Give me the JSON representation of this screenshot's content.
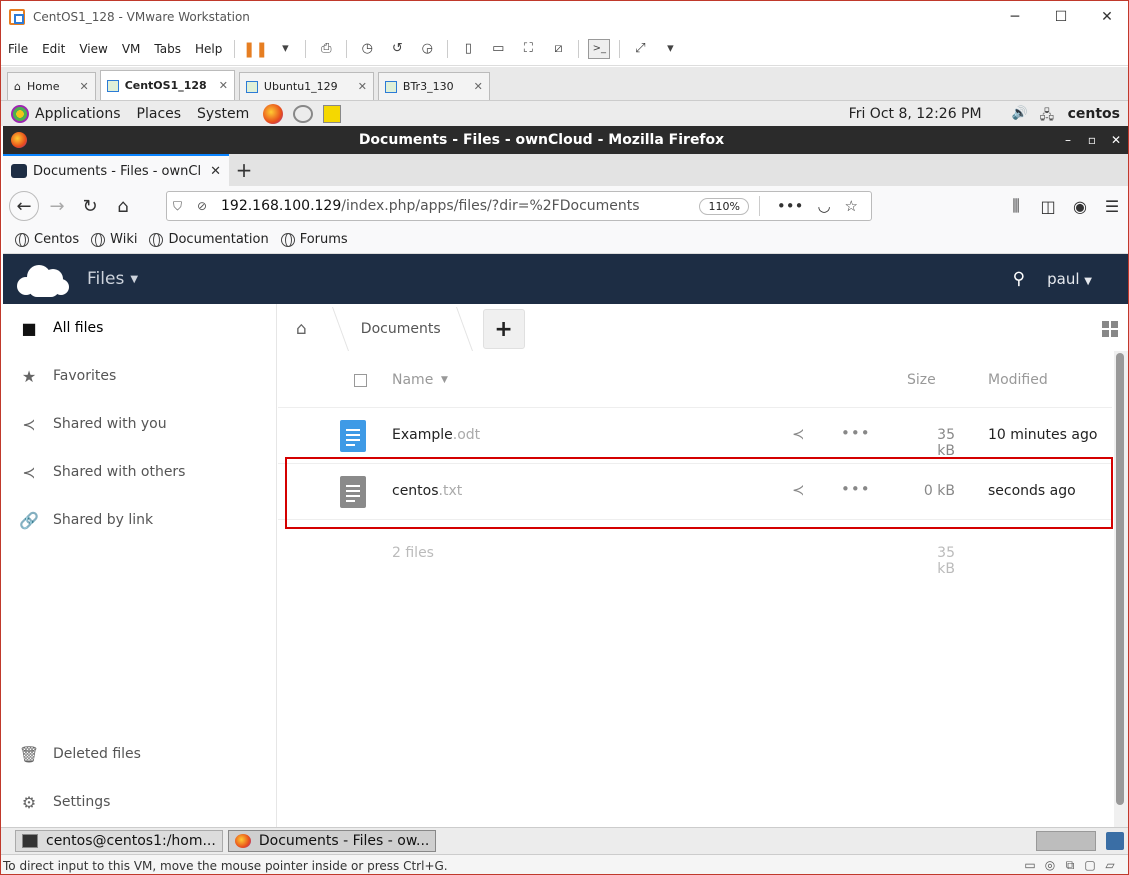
{
  "vmware": {
    "title": "CentOS1_128 - VMware Workstation",
    "menu": [
      "File",
      "Edit",
      "View",
      "VM",
      "Tabs",
      "Help"
    ],
    "tabs": [
      {
        "label": "Home"
      },
      {
        "label": "CentOS1_128"
      },
      {
        "label": "Ubuntu1_129"
      },
      {
        "label": "BTr3_130"
      }
    ],
    "status": "To direct input to this VM, move the mouse pointer inside or press Ctrl+G."
  },
  "gnome": {
    "menus": [
      "Applications",
      "Places",
      "System"
    ],
    "clock": "Fri Oct  8, 12:26 PM",
    "user": "centos"
  },
  "firefox": {
    "window_title": "Documents - Files - ownCloud - Mozilla Firefox",
    "tab_label": "Documents - Files - ownCl",
    "url_host": "192.168.100.129",
    "url_path": "/index.php/apps/files/?dir=%2FDocuments",
    "zoom": "110%",
    "bookmarks": [
      "Centos",
      "Wiki",
      "Documentation",
      "Forums"
    ]
  },
  "owncloud": {
    "app_name": "Files",
    "user": "paul",
    "sidebar": {
      "items": [
        "All files",
        "Favorites",
        "Shared with you",
        "Shared with others",
        "Shared by link"
      ],
      "bottom": [
        "Deleted files",
        "Settings"
      ]
    },
    "breadcrumb": "Documents",
    "columns": {
      "name": "Name",
      "size": "Size",
      "modified": "Modified"
    },
    "files": [
      {
        "name": "Example",
        "ext": ".odt",
        "size": "35 kB",
        "modified": "10 minutes ago",
        "icon_color": "#3e9ae6"
      },
      {
        "name": "centos",
        "ext": ".txt",
        "size": "0 kB",
        "modified": "seconds ago",
        "icon_color": "#8a8a8a"
      }
    ],
    "summary": {
      "count": "2 files",
      "total": "35 kB"
    }
  },
  "taskbar": [
    {
      "label": "centos@centos1:/hom..."
    },
    {
      "label": "Documents - Files - ow..."
    }
  ]
}
